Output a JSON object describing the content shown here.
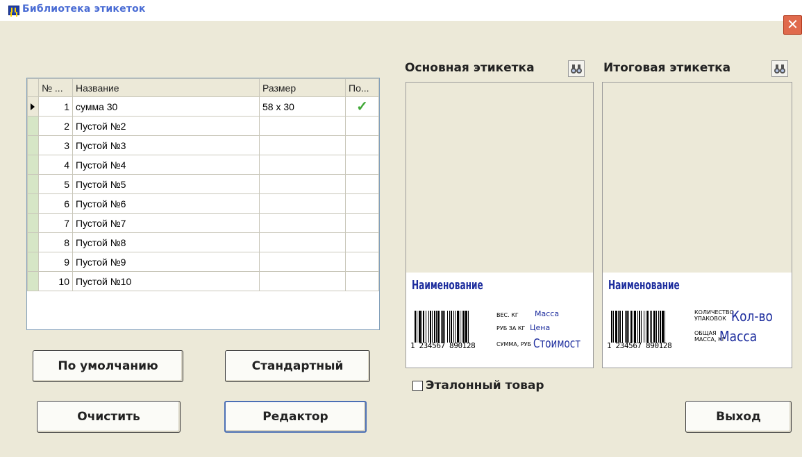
{
  "window": {
    "title": "Библиотека этикеток",
    "close_glyph": "✕"
  },
  "table": {
    "headers": [
      "№ ...",
      "Название",
      "Размер",
      "По..."
    ],
    "rows": [
      {
        "num": "1",
        "name": "сумма 30",
        "size": "58 x 30",
        "flag": "✓",
        "selected": true
      },
      {
        "num": "2",
        "name": "Пустой №2",
        "size": "",
        "flag": ""
      },
      {
        "num": "3",
        "name": "Пустой №3",
        "size": "",
        "flag": ""
      },
      {
        "num": "4",
        "name": "Пустой №4",
        "size": "",
        "flag": ""
      },
      {
        "num": "5",
        "name": "Пустой №5",
        "size": "",
        "flag": ""
      },
      {
        "num": "6",
        "name": "Пустой №6",
        "size": "",
        "flag": ""
      },
      {
        "num": "7",
        "name": "Пустой №7",
        "size": "",
        "flag": ""
      },
      {
        "num": "8",
        "name": "Пустой №8",
        "size": "",
        "flag": ""
      },
      {
        "num": "9",
        "name": "Пустой №9",
        "size": "",
        "flag": ""
      },
      {
        "num": "10",
        "name": "Пустой №10",
        "size": "",
        "flag": ""
      }
    ]
  },
  "buttons": {
    "default": "По умолчанию",
    "standard": "Стандартный",
    "clear": "Очистить",
    "editor": "Редактор",
    "exit": "Выход"
  },
  "main_label": {
    "title": "Основная этикетка",
    "name": "Наименование",
    "barcode_digits": "1 234567 890128",
    "weight_caption": "ВЕС. КГ",
    "weight_value": "Масса",
    "price_caption": "РУБ ЗА КГ",
    "price_value": "Цена",
    "sum_caption": "СУММА, РУБ",
    "sum_value": "Стоимост"
  },
  "total_label": {
    "title": "Итоговая этикетка",
    "name": "Наименование",
    "barcode_digits": "1 234567 890128",
    "qty_caption": "КОЛИЧЕСТВО УПАКОВОК",
    "qty_value": "Кол-во",
    "mass_caption": "ОБЩАЯ МАССА, КГ",
    "mass_value": "Масса"
  },
  "reference_checkbox": {
    "label": "Эталонный товар",
    "checked": false
  },
  "icons": {
    "find_main": "binoculars-icon",
    "find_total": "binoculars-icon"
  },
  "colors": {
    "window_bg": "#ece9d8",
    "label_blue": "#1e2e9e",
    "check_green": "#3fa836",
    "close_red": "#e06a4d"
  }
}
